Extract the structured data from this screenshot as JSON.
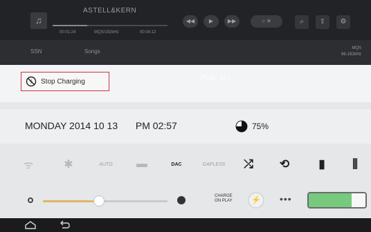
{
  "player": {
    "brand": "ASTELL&KERN",
    "meta_left": "00:01:24",
    "meta_mid": "MQS/192kHz",
    "meta_right": "00:04:12",
    "seek_progress": 0.3,
    "ctrl_prev": "◀◀",
    "ctrl_play": "▶",
    "ctrl_next": "▶▶",
    "ctrl_modes": "○ ✕",
    "icons": [
      "music-note-icon",
      "search-icon",
      "share-icon",
      "gear-icon"
    ]
  },
  "nav": {
    "tab_left": "SSN",
    "tab_songs": "Songs",
    "right_top": "MQS",
    "right_bottom": "96-192kHz"
  },
  "panel": {
    "stop_charging": "Stop Charging",
    "play_all": "PLAY ALL",
    "date": "MONDAY 2014 10 13",
    "time": "PM 02:57",
    "battery_percent_label": "75%",
    "battery_level": 0.75,
    "volume_level": 0.45,
    "charge_label_line1": "CHARGE",
    "charge_label_line2": "ON PLAY",
    "dots": "•••",
    "toggle_dac": "DAC",
    "toggle_gapless": "GAPLESS",
    "toggle_auto": "AUTO"
  },
  "colors": {
    "accent": "#e0b565",
    "danger": "#cf3040",
    "battery_fill": "#76c97d",
    "topbar": "#222326"
  }
}
